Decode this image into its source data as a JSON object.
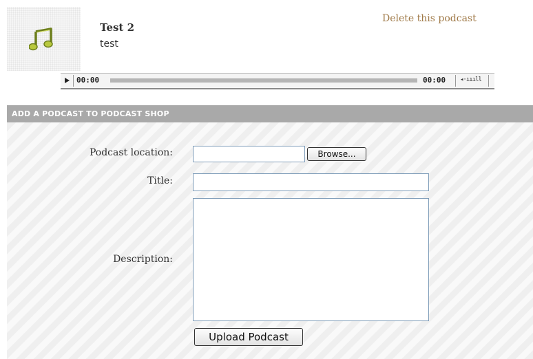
{
  "podcast": {
    "title": "Test 2",
    "description": "test",
    "delete_label": "Delete this podcast",
    "icon": "music-note-icon"
  },
  "player": {
    "current_time": "00:00",
    "total_time": "00:00",
    "volume_glyph": "◂·ıııll",
    "progress": 0
  },
  "section": {
    "header": "ADD A PODCAST TO PODCAST SHOP"
  },
  "form": {
    "location_label": "Podcast location:",
    "location_value": "",
    "browse_label": "Browse...",
    "title_label": "Title:",
    "title_value": "",
    "description_label": "Description:",
    "description_value": "",
    "upload_label": "Upload Podcast"
  },
  "colors": {
    "link": "#a07a48",
    "section_bar": "#a9a9a9",
    "input_border": "#7f9db9"
  }
}
